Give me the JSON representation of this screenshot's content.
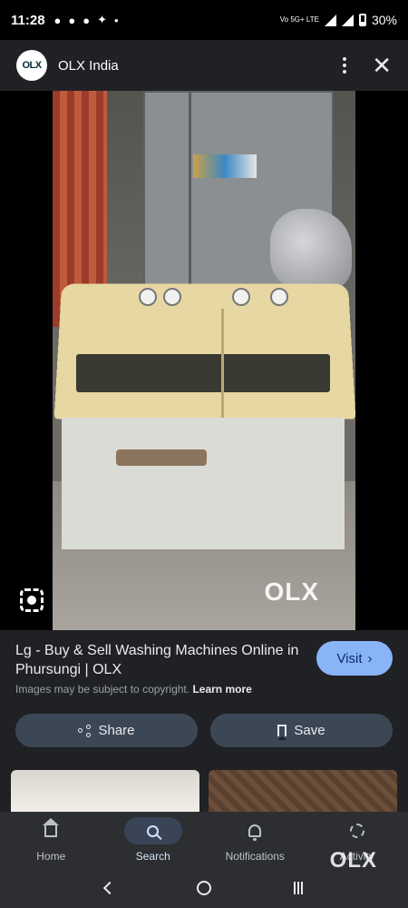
{
  "status_bar": {
    "time": "11:28",
    "network": "Vo 5G+ LTE",
    "battery": "30%"
  },
  "header": {
    "logo_text": "OLX",
    "title": "OLX India"
  },
  "image": {
    "watermark": "OLX"
  },
  "result": {
    "title": "Lg - Buy & Sell Washing Machines Online in Phursungi | OLX",
    "copyright": "Images may be subject to copyright.",
    "learn_more": "Learn more",
    "visit_label": "Visit"
  },
  "actions": {
    "share_label": "Share",
    "save_label": "Save"
  },
  "bottom_nav": {
    "items": [
      {
        "label": "Home",
        "icon": "home-icon"
      },
      {
        "label": "Search",
        "icon": "search-icon",
        "active": true
      },
      {
        "label": "Notifications",
        "icon": "bell-icon"
      },
      {
        "label": "Activity",
        "icon": "activity-icon"
      }
    ],
    "overlay_logo": "OLX"
  },
  "colors": {
    "accent": "#8ab4f8",
    "background": "#202124",
    "button_bg": "#3c4756"
  }
}
